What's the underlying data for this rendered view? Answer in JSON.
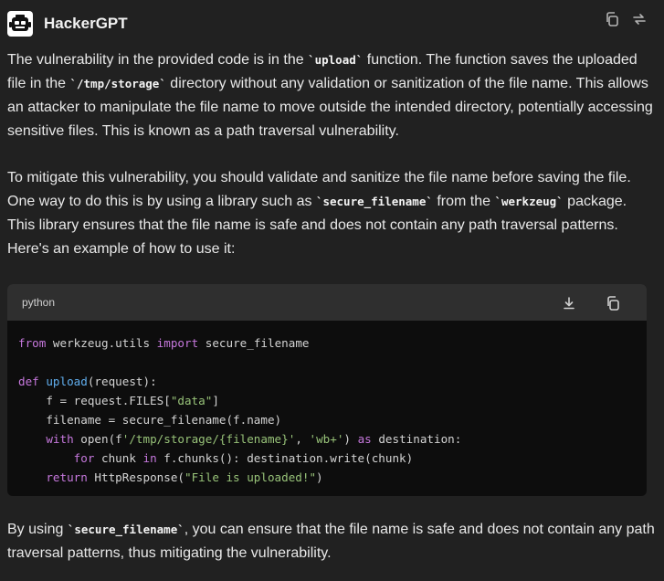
{
  "header": {
    "assistant_name": "HackerGPT",
    "avatar_icon": "robot-face-icon",
    "actions": [
      "copy-icon",
      "regenerate-icon"
    ]
  },
  "message": {
    "p1": {
      "t1": "The vulnerability in the provided code is in the ",
      "c1": "`upload`",
      "t2": " function. The function saves the uploaded file in the ",
      "c2": "`/tmp/storage`",
      "t3": " directory without any validation or sanitization of the file name. This allows an attacker to manipulate the file name to move outside the intended directory, potentially accessing sensitive files. This is known as a path traversal vulnerability."
    },
    "p2": {
      "t1": "To mitigate this vulnerability, you should validate and sanitize the file name before saving the file. One way to do this is by using a library such as ",
      "c1": "`secure_filename`",
      "t2": " from the ",
      "c2": "`werkzeug`",
      "t3": " package. This library ensures that the file name is safe and does not contain any path traversal patterns. Here's an example of how to use it:"
    },
    "p3": {
      "t1": "By using ",
      "c1": "`secure_filename`",
      "t2": ", you can ensure that the file name is safe and does not contain any path traversal patterns, thus mitigating the vulnerability."
    }
  },
  "code_block": {
    "language": "python",
    "actions": [
      "download-icon",
      "copy-icon"
    ],
    "tokens": {
      "l1_kw1": "from",
      "l1_mod": " werkzeug.utils ",
      "l1_kw2": "import",
      "l1_name": " secure_filename",
      "l3_kw": "def",
      "l3_fn": "upload",
      "l3_rest": "(request):",
      "l4_a": "    f = request.FILES[",
      "l4_str": "\"data\"",
      "l4_b": "]",
      "l5": "    filename = secure_filename(f.name)",
      "l6_kw": "    with",
      "l6_a": " open(f",
      "l6_str1": "'/tmp/storage/{filename}'",
      "l6_b": ", ",
      "l6_str2": "'wb+'",
      "l6_c": ") ",
      "l6_kw2": "as",
      "l6_d": " destination:",
      "l7_kw": "        for",
      "l7_a": " chunk ",
      "l7_kw2": "in",
      "l7_b": " f.chunks(): destination.write(chunk)",
      "l8_kw": "    return",
      "l8_a": " HttpResponse(",
      "l8_str": "\"File is uploaded!\"",
      "l8_b": ")"
    }
  }
}
